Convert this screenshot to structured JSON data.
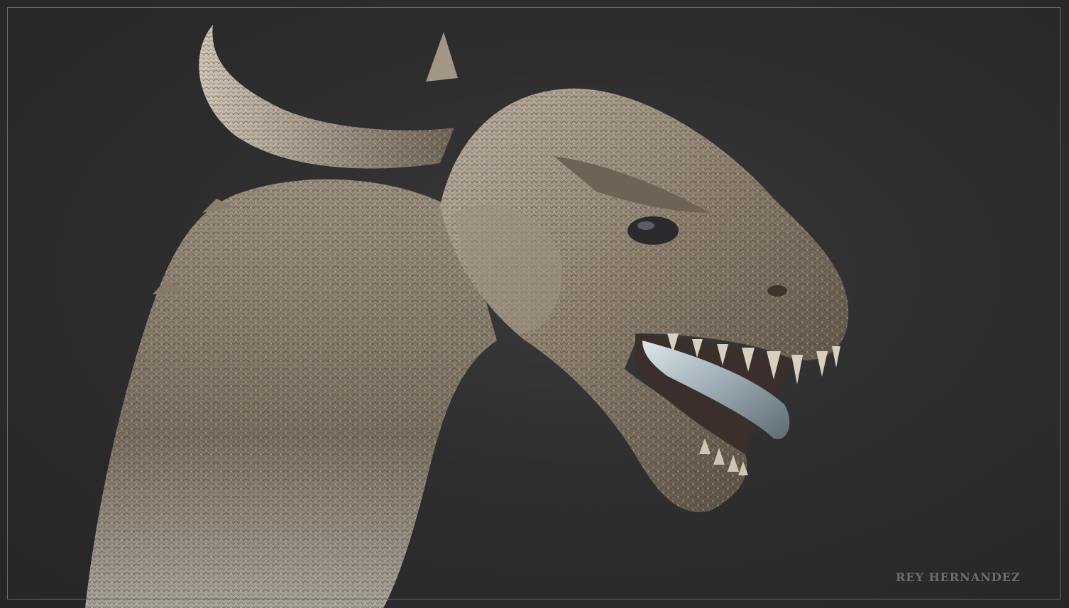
{
  "artwork": {
    "subject": "dragon-head-sculpt",
    "signature": "REY HERNANDEZ"
  },
  "colors": {
    "background": "#2e2e2e",
    "frame": "#6a6a6a",
    "scales_light": "#c9c0b2",
    "scales_mid": "#8f8373",
    "scales_dark": "#4a4136",
    "tongue": "#b8c4cc",
    "signature": "#6c6c6c"
  }
}
